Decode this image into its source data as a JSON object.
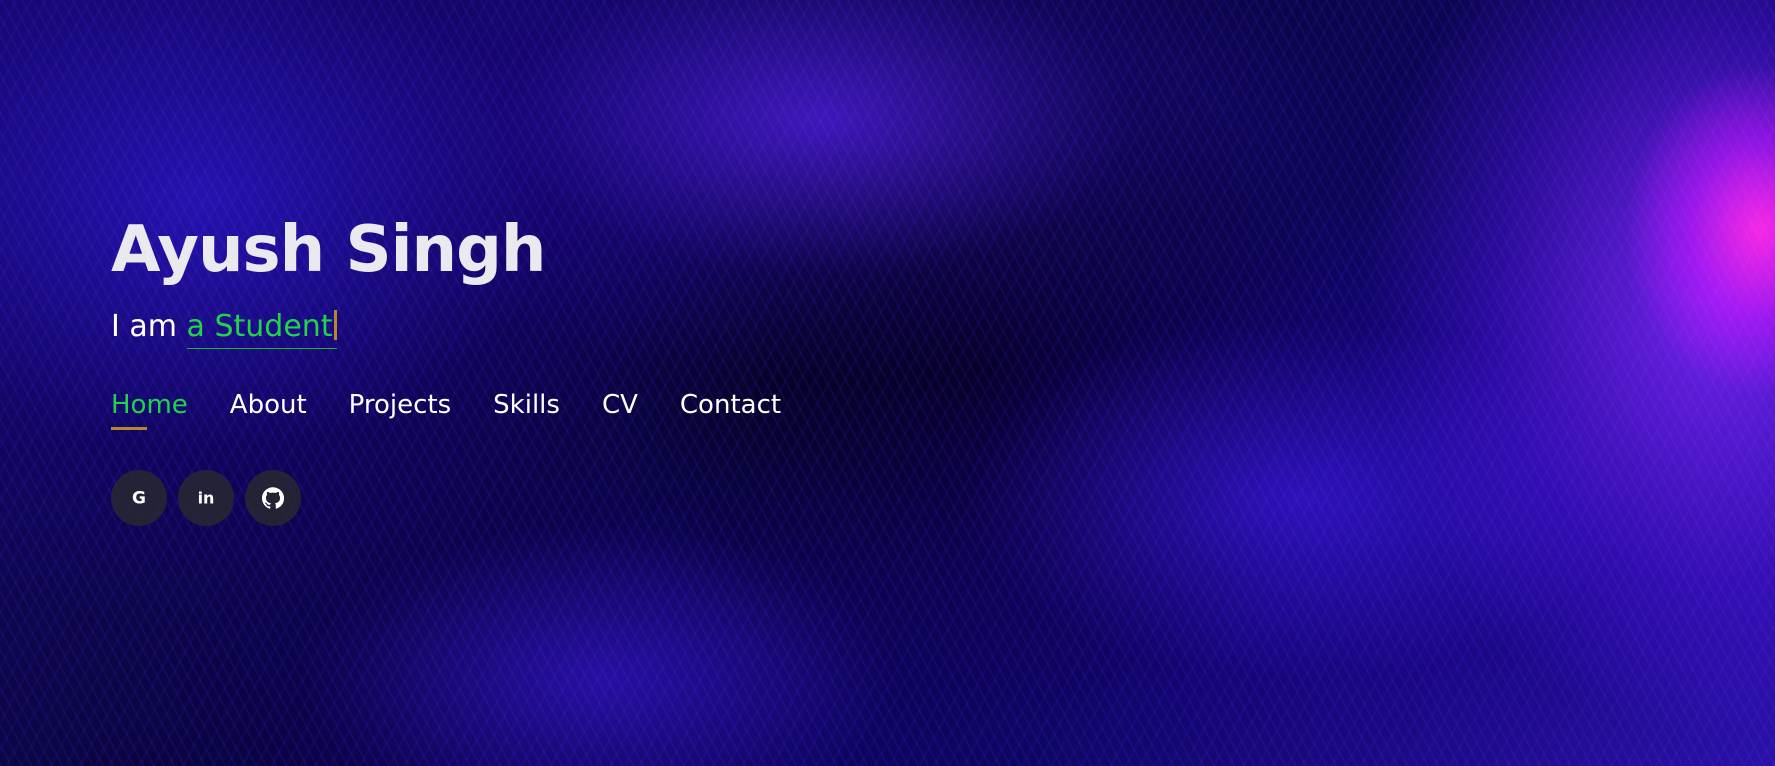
{
  "hero": {
    "name": "Ayush Singh",
    "tagline_prefix": "I am ",
    "typed_text": "a Student"
  },
  "nav": {
    "items": [
      {
        "label": "Home",
        "active": true
      },
      {
        "label": "About",
        "active": false
      },
      {
        "label": "Projects",
        "active": false
      },
      {
        "label": "Skills",
        "active": false
      },
      {
        "label": "CV",
        "active": false
      },
      {
        "label": "Contact",
        "active": false
      }
    ]
  },
  "socials": [
    {
      "icon": "google-icon",
      "glyph": "G"
    },
    {
      "icon": "linkedin-icon",
      "glyph": "in"
    },
    {
      "icon": "github-icon"
    }
  ],
  "colors": {
    "accent_green": "#22d34a",
    "accent_gold": "#b8862a",
    "name_text": "#e9e9ef",
    "social_bg": "#28282f"
  }
}
